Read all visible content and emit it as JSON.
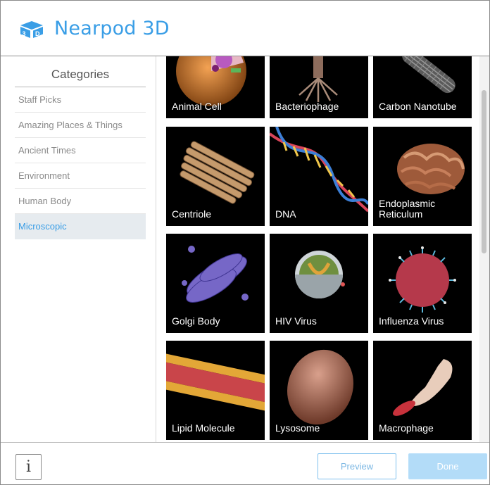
{
  "app": {
    "title": "Nearpod 3D",
    "logo_icon": "cube-3d-icon",
    "accent": "#3a9ee6"
  },
  "sidebar": {
    "title": "Categories",
    "items": [
      {
        "label": "Staff Picks",
        "active": false
      },
      {
        "label": "Amazing Places & Things",
        "active": false
      },
      {
        "label": "Ancient Times",
        "active": false
      },
      {
        "label": "Environment",
        "active": false
      },
      {
        "label": "Human Body",
        "active": false
      },
      {
        "label": "Microscopic",
        "active": true
      }
    ]
  },
  "models": [
    {
      "label": "Animal Cell",
      "thumb": "animal-cell-thumbnail"
    },
    {
      "label": "Bacteriophage",
      "thumb": "bacteriophage-thumbnail"
    },
    {
      "label": "Carbon Nanotube",
      "thumb": "carbon-nanotube-thumbnail"
    },
    {
      "label": "Centriole",
      "thumb": "centriole-thumbnail"
    },
    {
      "label": "DNA",
      "thumb": "dna-thumbnail"
    },
    {
      "label": "Endoplasmic Reticulum",
      "thumb": "endoplasmic-reticulum-thumbnail"
    },
    {
      "label": "Golgi Body",
      "thumb": "golgi-body-thumbnail"
    },
    {
      "label": "HIV Virus",
      "thumb": "hiv-virus-thumbnail"
    },
    {
      "label": "Influenza Virus",
      "thumb": "influenza-virus-thumbnail"
    },
    {
      "label": "Lipid Molecule",
      "thumb": "lipid-molecule-thumbnail"
    },
    {
      "label": "Lysosome",
      "thumb": "lysosome-thumbnail"
    },
    {
      "label": "Macrophage",
      "thumb": "macrophage-thumbnail"
    }
  ],
  "footer": {
    "info_label": "i",
    "preview_label": "Preview",
    "done_label": "Done",
    "done_enabled": false
  }
}
